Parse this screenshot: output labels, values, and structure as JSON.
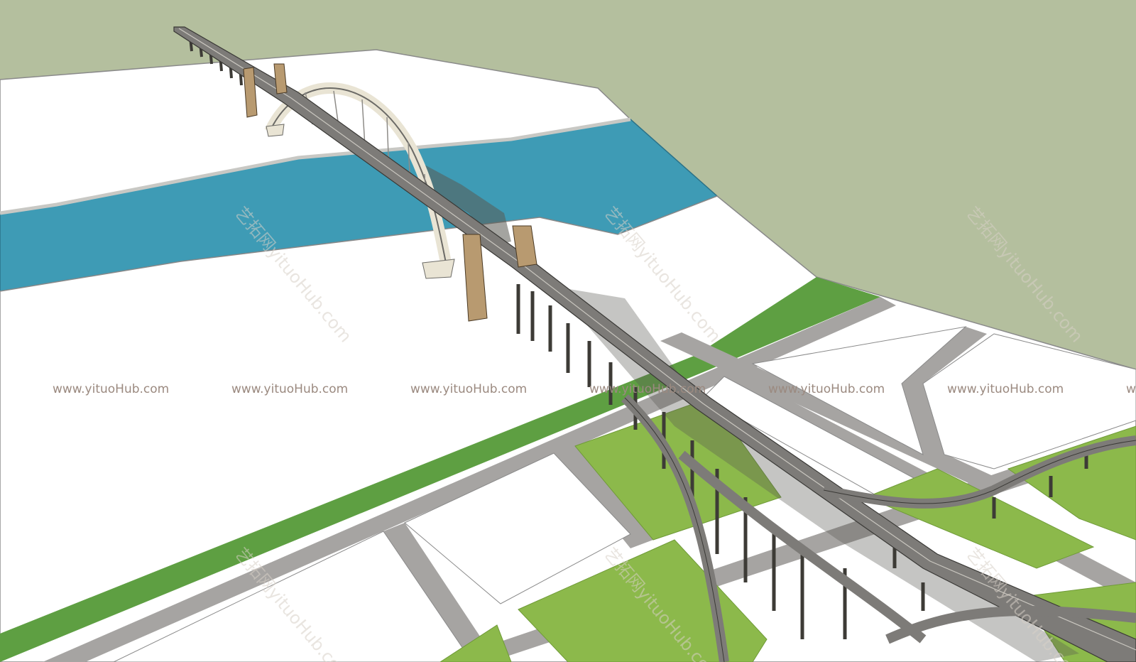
{
  "scene": {
    "subject": "SketchUp-style 3D model of an arch bridge crossing a river with elevated road interchange",
    "colors": {
      "background": "#b4bf9e",
      "ground": "#ffffff",
      "river": "#3e9bb5",
      "grass_dark": "#5e9f42",
      "grass_light": "#8cb94b",
      "road": "#a6a4a2",
      "deck": "#7d7b78",
      "arch": "#e9e4d4",
      "tower": "#b89a70",
      "pier": "#3d3b36",
      "shadow": "#5a5a52"
    }
  },
  "watermark": {
    "text": "www.yituoHub.com",
    "diagonal_text": "艺拓网yituoHub.com",
    "repeat_count": 7
  }
}
